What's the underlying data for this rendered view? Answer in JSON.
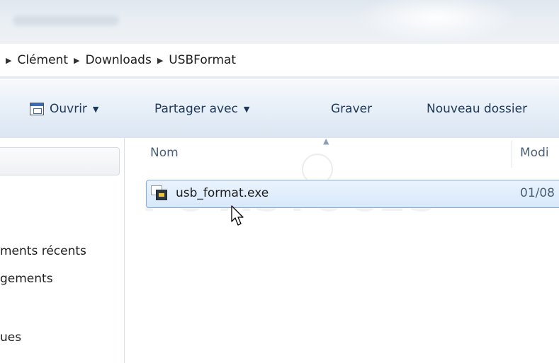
{
  "breadcrumb": [
    "Clément",
    "Downloads",
    "USBFormat"
  ],
  "toolbar": {
    "open_label": "Ouvrir",
    "share_label": "Partager avec",
    "burn_label": "Graver",
    "new_folder_label": "Nouveau dossier"
  },
  "navpane": {
    "items": [
      "ments récents",
      "gements",
      "ues"
    ]
  },
  "columns": {
    "name": "Nom",
    "modified": "Modi"
  },
  "files": [
    {
      "name": "usb_format.exe",
      "date": "01/08"
    }
  ],
  "watermark": "PC ASTUCES",
  "colors": {
    "selection": "#d8e8fa",
    "selection_border": "#84acdd",
    "toolbar_text": "#1e395b"
  },
  "icons": [
    "open-window-icon",
    "exe-file-icon",
    "mouse-cursor-icon",
    "dropdown-arrow-icon",
    "breadcrumb-arrow-icon"
  ]
}
